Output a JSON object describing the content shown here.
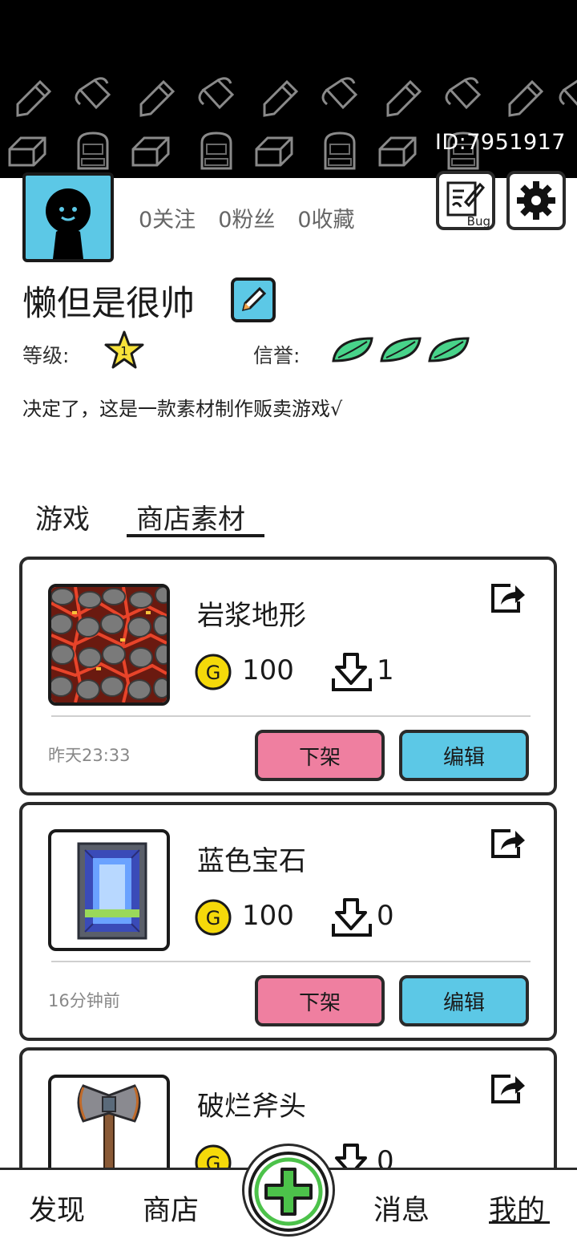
{
  "header": {
    "user_id": "ID:7951917",
    "background_color": "#000000"
  },
  "profile": {
    "avatar_icon": "silhouette-avatar-icon",
    "stats": {
      "following": "0关注",
      "followers": "0粉丝",
      "favorites": "0收藏"
    },
    "bug_button_label": "Bug",
    "username": "懒但是很帅",
    "level_label": "等级:",
    "level_value": "1",
    "credit_label": "信誉:",
    "credit_leaves": 3,
    "bio": "决定了，这是一款素材制作贩卖游戏√"
  },
  "tabs": [
    {
      "label": "游戏",
      "active": false
    },
    {
      "label": "商店素材",
      "active": true
    }
  ],
  "items": [
    {
      "title": "岩浆地形",
      "price": "100",
      "downloads": "1",
      "time": "昨天23:33",
      "unlist_label": "下架",
      "edit_label": "编辑",
      "thumb": "lava-terrain"
    },
    {
      "title": "蓝色宝石",
      "price": "100",
      "downloads": "0",
      "time": "16分钟前",
      "unlist_label": "下架",
      "edit_label": "编辑",
      "thumb": "blue-gem"
    },
    {
      "title": "破烂斧头",
      "price": "",
      "downloads": "0",
      "thumb": "broken-axe"
    }
  ],
  "nav": {
    "discover": "发现",
    "shop": "商店",
    "messages": "消息",
    "mine": "我的",
    "active": "我的"
  },
  "colors": {
    "accent_blue": "#5cc8e6",
    "unlist_pink": "#ef7fa0",
    "coin_yellow": "#f5d90a",
    "leaf_green": "#48d38a",
    "add_green": "#4cc24a"
  }
}
